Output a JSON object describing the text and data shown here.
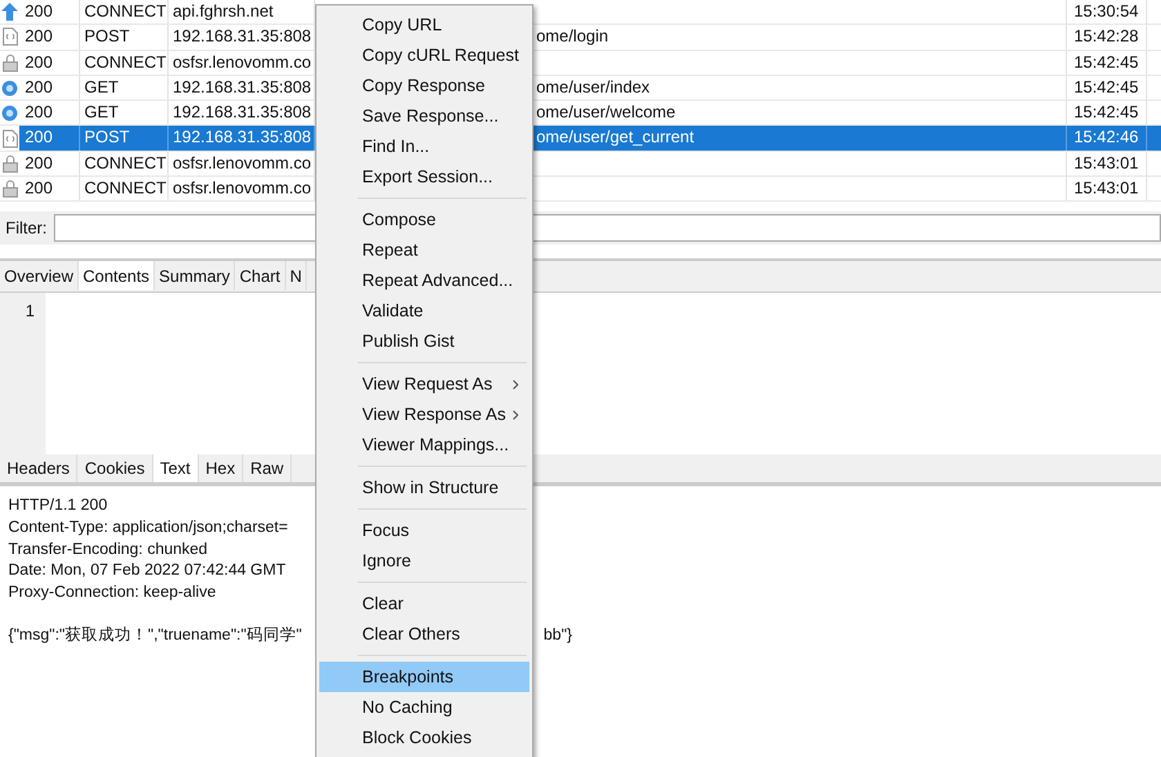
{
  "sessions": [
    {
      "kind": "upload",
      "result": "200",
      "method": "CONNECT",
      "host": "api.fghrsh.net",
      "time": "15:30:54",
      "selected": false
    },
    {
      "kind": "json",
      "result": "200",
      "method": "POST",
      "host": "192.168.31.35:808",
      "url": "ome/login",
      "time": "15:42:28",
      "selected": false
    },
    {
      "kind": "tunnel",
      "result": "200",
      "method": "CONNECT",
      "host": "osfsr.lenovomm.co",
      "time": "15:42:45",
      "selected": false
    },
    {
      "kind": "page",
      "result": "200",
      "method": "GET",
      "host": "192.168.31.35:808",
      "url": "ome/user/index",
      "time": "15:42:45",
      "selected": false
    },
    {
      "kind": "page",
      "result": "200",
      "method": "GET",
      "host": "192.168.31.35:808",
      "url": "ome/user/welcome",
      "time": "15:42:45",
      "selected": false
    },
    {
      "kind": "json",
      "result": "200",
      "method": "POST",
      "host": "192.168.31.35:808",
      "url": "ome/user/get_current",
      "time": "15:42:46",
      "selected": true
    },
    {
      "kind": "tunnel",
      "result": "200",
      "method": "CONNECT",
      "host": "osfsr.lenovomm.co",
      "time": "15:43:01",
      "selected": false
    },
    {
      "kind": "tunnel",
      "result": "200",
      "method": "CONNECT",
      "host": "osfsr.lenovomm.co",
      "time": "15:43:01",
      "selected": false
    }
  ],
  "filter": {
    "label": "Filter:"
  },
  "tabs": [
    {
      "label": "Overview",
      "selected": false
    },
    {
      "label": "Contents",
      "selected": true
    },
    {
      "label": "Summary",
      "selected": false
    },
    {
      "label": "Chart",
      "selected": false
    },
    {
      "label": "N",
      "selected": false
    }
  ],
  "editor": {
    "line_numbers": [
      "1"
    ]
  },
  "sub_tabs": [
    {
      "label": "Headers",
      "selected": false
    },
    {
      "label": "Cookies",
      "selected": false
    },
    {
      "label": "Text",
      "selected": true
    },
    {
      "label": "Hex",
      "selected": false
    },
    {
      "label": "Raw",
      "selected": false
    }
  ],
  "response": {
    "lines": [
      "HTTP/1.1 200",
      "Content-Type: application/json;charset=",
      "Transfer-Encoding: chunked",
      "Date: Mon, 07 Feb 2022 07:42:44 GMT",
      "Proxy-Connection: keep-alive"
    ],
    "body_left": "{\"msg\":\"获取成功！\",\"truename\":\"码同学\"",
    "body_right": "bb\"}"
  },
  "context_menu": {
    "items": [
      {
        "kind": "item",
        "label": "Copy URL",
        "submenu": false,
        "selected": false
      },
      {
        "kind": "item",
        "label": "Copy cURL Request",
        "submenu": false,
        "selected": false
      },
      {
        "kind": "item",
        "label": "Copy Response",
        "submenu": false,
        "selected": false
      },
      {
        "kind": "item",
        "label": "Save Response...",
        "submenu": false,
        "selected": false
      },
      {
        "kind": "item",
        "label": "Find In...",
        "submenu": false,
        "selected": false
      },
      {
        "kind": "item",
        "label": "Export Session...",
        "submenu": false,
        "selected": false
      },
      {
        "kind": "separator"
      },
      {
        "kind": "item",
        "label": "Compose",
        "submenu": false,
        "selected": false
      },
      {
        "kind": "item",
        "label": "Repeat",
        "submenu": false,
        "selected": false
      },
      {
        "kind": "item",
        "label": "Repeat Advanced...",
        "submenu": false,
        "selected": false
      },
      {
        "kind": "item",
        "label": "Validate",
        "submenu": false,
        "selected": false
      },
      {
        "kind": "item",
        "label": "Publish Gist",
        "submenu": false,
        "selected": false
      },
      {
        "kind": "separator"
      },
      {
        "kind": "item",
        "label": "View Request As",
        "submenu": true,
        "selected": false
      },
      {
        "kind": "item",
        "label": "View Response As",
        "submenu": true,
        "selected": false
      },
      {
        "kind": "item",
        "label": "Viewer Mappings...",
        "submenu": false,
        "selected": false
      },
      {
        "kind": "separator"
      },
      {
        "kind": "item",
        "label": "Show in Structure",
        "submenu": false,
        "selected": false
      },
      {
        "kind": "separator"
      },
      {
        "kind": "item",
        "label": "Focus",
        "submenu": false,
        "selected": false
      },
      {
        "kind": "item",
        "label": "Ignore",
        "submenu": false,
        "selected": false
      },
      {
        "kind": "separator"
      },
      {
        "kind": "item",
        "label": "Clear",
        "submenu": false,
        "selected": false
      },
      {
        "kind": "item",
        "label": "Clear Others",
        "submenu": false,
        "selected": false
      },
      {
        "kind": "separator"
      },
      {
        "kind": "item",
        "label": "Breakpoints",
        "submenu": false,
        "selected": true
      },
      {
        "kind": "item",
        "label": "No Caching",
        "submenu": false,
        "selected": false
      },
      {
        "kind": "item",
        "label": "Block Cookies",
        "submenu": false,
        "selected": false
      }
    ]
  }
}
